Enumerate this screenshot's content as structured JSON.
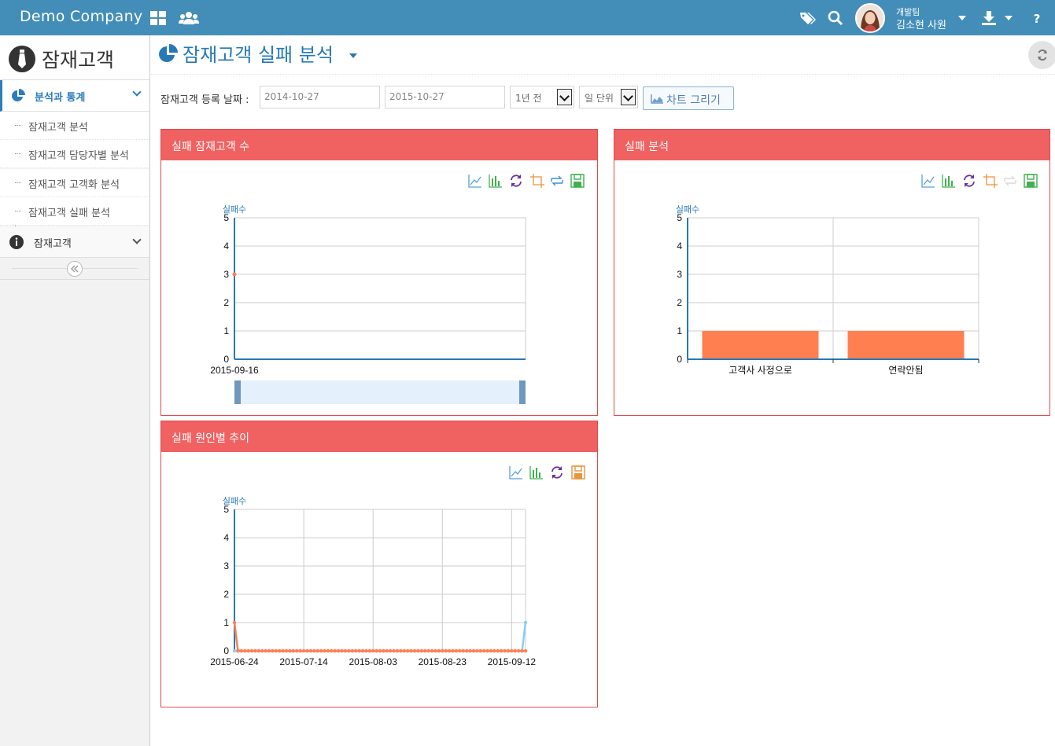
{
  "header": {
    "brand": "Demo Company",
    "user_team": "개발팀",
    "user_name": "김소현 사원"
  },
  "sidebar": {
    "title": "잠재고객",
    "groups": [
      {
        "label": "분석과 통계",
        "items": [
          "잠재고객 분석",
          "잠재고객 담당자별 분석",
          "잠재고객 고객화 분석",
          "잠재고객 실패 분석"
        ]
      },
      {
        "label": "잠재고객",
        "items": []
      }
    ]
  },
  "page": {
    "title": "잠재고객 실패 분석"
  },
  "filter": {
    "label": "잠재고객 등록 날짜 :",
    "start_date": "2014-10-27",
    "end_date": "2015-10-27",
    "period": "1년 전",
    "unit": "일 단위",
    "draw_button": "차트 그리기"
  },
  "colors": {
    "navbar": "#438eb9",
    "panel_header": "#f06161",
    "series_main": "#ff7f50",
    "series_alt": "#87cefa",
    "axis": "#2679b5"
  },
  "chart_data": [
    {
      "title": "실패 잠재고객 수",
      "type": "line",
      "ylabel": "실패수",
      "ylim": [
        0,
        5
      ],
      "yticks": [
        0,
        1,
        2,
        3,
        4,
        5
      ],
      "x": [
        "2015-09-16"
      ],
      "series": [
        {
          "values": [
            3
          ]
        }
      ],
      "datazoom": true,
      "grid": true
    },
    {
      "title": "실패 분석",
      "type": "bar",
      "ylabel": "실패수",
      "ylim": [
        0,
        5
      ],
      "yticks": [
        0,
        1,
        2,
        3,
        4,
        5
      ],
      "categories": [
        "고객사 사정으로",
        "연락안됨"
      ],
      "values": [
        1,
        1
      ],
      "grid": true
    },
    {
      "title": "실패 원인별 추이",
      "type": "line",
      "ylabel": "실패수",
      "ylim": [
        0,
        5
      ],
      "yticks": [
        0,
        1,
        2,
        3,
        4,
        5
      ],
      "xlim": [
        "2015-06-24",
        "2015-09-16"
      ],
      "xticks": [
        "2015-06-24",
        "2015-07-14",
        "2015-08-03",
        "2015-08-23",
        "2015-09-12"
      ],
      "series": [
        {
          "points": [
            [
              "2015-06-24",
              1
            ],
            [
              "2015-06-25",
              0
            ],
            [
              "2015-09-16",
              0
            ]
          ]
        },
        {
          "points": [
            [
              "2015-06-24",
              0
            ],
            [
              "2015-09-15",
              0
            ],
            [
              "2015-09-16",
              1
            ]
          ]
        }
      ],
      "grid": true
    }
  ]
}
